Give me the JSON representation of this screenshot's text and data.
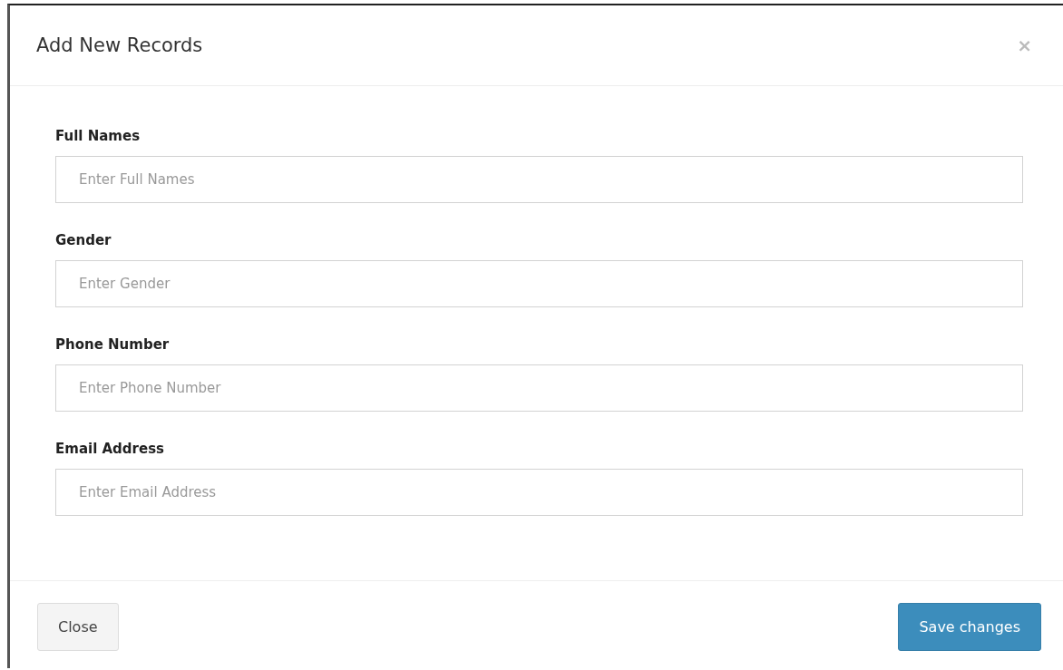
{
  "dialog": {
    "title": "Add New Records",
    "close_glyph": "×"
  },
  "fields": [
    {
      "label": "Full Names",
      "placeholder": "Enter Full Names"
    },
    {
      "label": "Gender",
      "placeholder": "Enter Gender"
    },
    {
      "label": "Phone Number",
      "placeholder": "Enter Phone Number"
    },
    {
      "label": "Email Address",
      "placeholder": "Enter Email Address"
    }
  ],
  "buttons": [
    {
      "label": "Close",
      "kind": "secondary"
    },
    {
      "label": "Save changes",
      "kind": "primary"
    }
  ]
}
